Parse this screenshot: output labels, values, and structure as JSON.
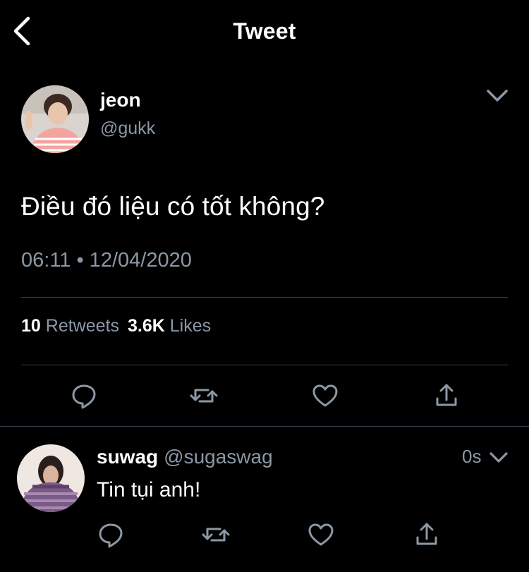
{
  "header": {
    "title": "Tweet"
  },
  "tweet": {
    "author_name": "jeon",
    "author_handle": "@gukk",
    "text": "Điều đó liệu có tốt không?",
    "time": "06:11 • 12/04/2020",
    "retweets_count": "10",
    "retweets_label": "Retweets",
    "likes_count": "3.6K",
    "likes_label": "Likes"
  },
  "reply": {
    "author_name": "suwag",
    "author_handle": "@sugaswag",
    "time": "0s",
    "text": "Tin tụi anh!"
  },
  "icons": {
    "back": "chevron-left-icon",
    "more": "chevron-down-icon",
    "reply": "reply-bubble-icon",
    "retweet": "retweet-icon",
    "like": "heart-icon",
    "share": "share-icon"
  },
  "colors": {
    "background": "#000000",
    "text": "#ffffff",
    "secondary_text": "#8b98a5",
    "divider": "#38444d",
    "icon": "#8b98a5"
  }
}
